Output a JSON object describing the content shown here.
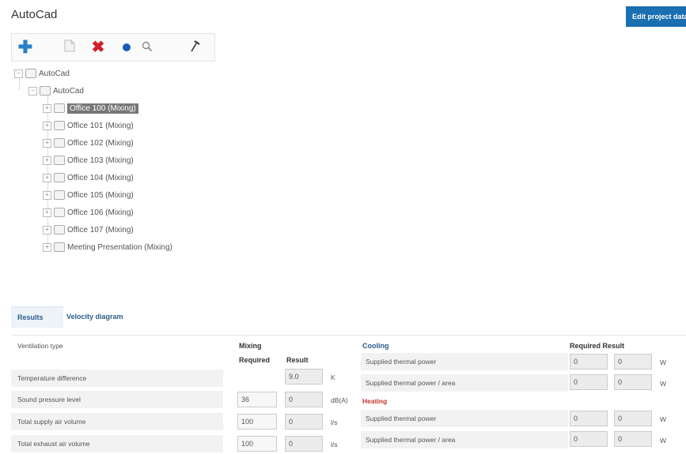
{
  "header": {
    "title": "AutoCad",
    "edit_label": "Edit project data"
  },
  "toolbar": {
    "icons": [
      "add-icon",
      "document-icon",
      "delete-icon",
      "dot-icon",
      "search-icon",
      "pin-icon"
    ]
  },
  "tree": {
    "root": "AutoCad",
    "child": "AutoCad",
    "rooms": [
      "Office 100 (Mixing)",
      "Office 101 (Mixing)",
      "Office 102 (Mixing)",
      "Office 103 (Mixing)",
      "Office 104 (Mixing)",
      "Office 105 (Mixing)",
      "Office 106 (Mixing)",
      "Office 107 (Mixing)",
      "Meeting Presentation (Mixing)"
    ],
    "selected_index": 0
  },
  "tabs": [
    "Results",
    "Velocity diagram"
  ],
  "results": {
    "ventilation_type_label": "Ventilation type",
    "mixing_label": "Mixing",
    "required_label": "Required",
    "result_label": "Result",
    "rows": [
      {
        "label": "Temperature difference",
        "required": "",
        "result": "9.0",
        "unit": "K"
      },
      {
        "label": "Sound pressure level",
        "required": "36",
        "result": "0",
        "unit": "dB(A)"
      },
      {
        "label": "Total supply air volume",
        "required": "100",
        "result": "0",
        "unit": "l/s"
      },
      {
        "label": "Total exhaust air volume",
        "required": "100",
        "result": "0",
        "unit": "l/s"
      }
    ],
    "cooling": {
      "label": "Cooling",
      "rows": [
        {
          "label": "Supplied thermal power",
          "required": "0",
          "result": "0",
          "unit": "W"
        },
        {
          "label": "Supplied thermal power / area",
          "required": "0",
          "result": "0",
          "unit": "W"
        }
      ]
    },
    "heating": {
      "label": "Heating",
      "rows": [
        {
          "label": "Supplied thermal power",
          "required": "0",
          "result": "0",
          "unit": "W"
        },
        {
          "label": "Supplied thermal power / area",
          "required": "0",
          "result": "0",
          "unit": "W"
        }
      ]
    },
    "right_required_result_label": "Required Result"
  }
}
